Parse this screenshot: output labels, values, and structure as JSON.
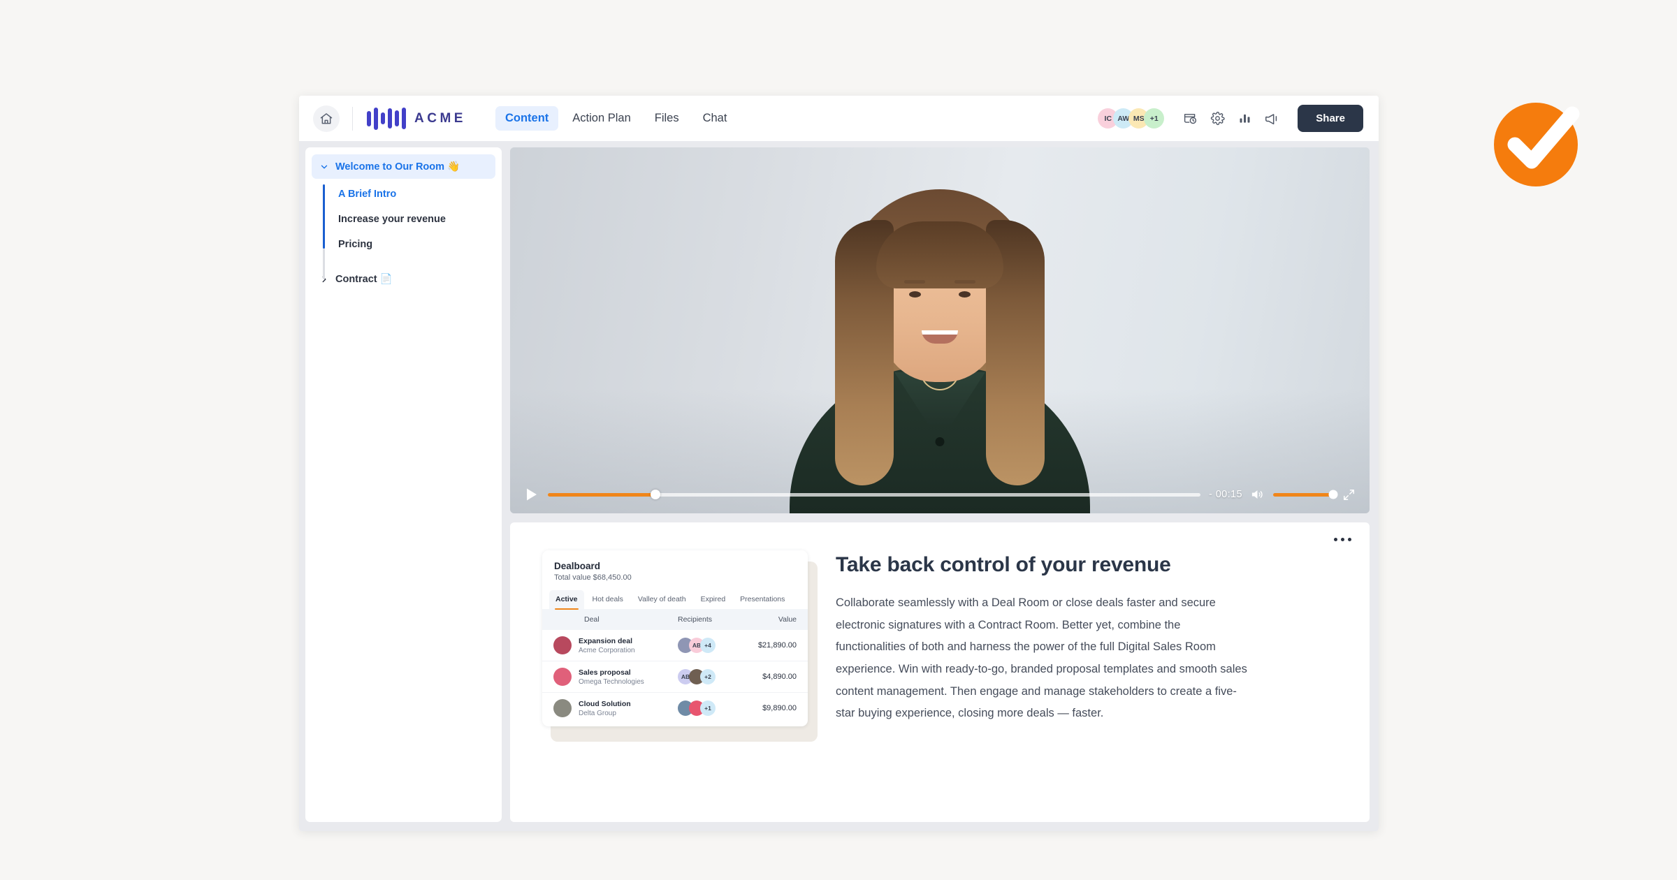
{
  "header": {
    "home_icon": "home-icon",
    "logo_text": "ACME",
    "nav": [
      {
        "label": "Content",
        "active": true
      },
      {
        "label": "Action Plan",
        "active": false
      },
      {
        "label": "Files",
        "active": false
      },
      {
        "label": "Chat",
        "active": false
      }
    ],
    "avatars": [
      {
        "initials": "IC",
        "color": "#f9d0dc"
      },
      {
        "initials": "AW",
        "color": "#cdeaf6"
      },
      {
        "initials": "MS",
        "color": "#fbe8b4"
      },
      {
        "initials": "+1",
        "color": "#c8efcb"
      }
    ],
    "icons": [
      {
        "name": "activity-history-icon"
      },
      {
        "name": "gear-icon"
      },
      {
        "name": "bar-chart-icon"
      },
      {
        "name": "megaphone-icon"
      }
    ],
    "share_label": "Share"
  },
  "sidebar": {
    "group": {
      "label": "Welcome to Our Room 👋",
      "expanded": true
    },
    "children": [
      {
        "label": "A Brief Intro",
        "active": true
      },
      {
        "label": "Increase your revenue",
        "active": false
      },
      {
        "label": "Pricing",
        "active": false
      }
    ],
    "group2": {
      "label": "Contract 📄",
      "expanded": false
    }
  },
  "video": {
    "time_label": "- 00:15",
    "progress_percent": 16.5,
    "volume_percent": 100,
    "play_icon": "play-icon",
    "volume_icon": "volume-icon",
    "fullscreen_icon": "fullscreen-icon"
  },
  "content_card": {
    "menu_icon": "more-options-icon",
    "heading": "Take back control of your revenue",
    "body": "Collaborate seamlessly with a Deal Room or close deals faster and secure electronic signatures with a Contract Room. Better yet, combine the functionalities of both and harness the power of the full Digital Sales Room experience. Win with ready-to-go, branded proposal templates and smooth sales content management. Then engage and manage stakeholders to create a five-star buying experience, closing more deals — faster.",
    "dealboard": {
      "title": "Dealboard",
      "subtitle": "Total value $68,450.00",
      "tabs": [
        {
          "label": "Active",
          "active": true
        },
        {
          "label": "Hot deals",
          "active": false
        },
        {
          "label": "Valley of death",
          "active": false
        },
        {
          "label": "Expired",
          "active": false
        },
        {
          "label": "Presentations",
          "active": false
        }
      ],
      "columns": [
        "Deal",
        "Recipients",
        "Value"
      ],
      "rows": [
        {
          "deal": "Expansion deal",
          "company": "Acme Corporation",
          "avatar_color": "#b8495e",
          "recipients": [
            {
              "initials": "",
              "color": "#8f96b4"
            },
            {
              "initials": "AB",
              "color": "#f9ccd9"
            },
            {
              "initials": "+4",
              "color": "#cfe9f7"
            }
          ],
          "value": "$21,890.00"
        },
        {
          "deal": "Sales proposal",
          "company": "Omega Technologies",
          "avatar_color": "#e0607a",
          "recipients": [
            {
              "initials": "AB",
              "color": "#ccccf0"
            },
            {
              "initials": "",
              "color": "#6f5f52"
            },
            {
              "initials": "+2",
              "color": "#cfe9f7"
            }
          ],
          "value": "$4,890.00"
        },
        {
          "deal": "Cloud Solution",
          "company": "Delta Group",
          "avatar_color": "#8a8a80",
          "recipients": [
            {
              "initials": "",
              "color": "#6f8ba6"
            },
            {
              "initials": "",
              "color": "#e8556f"
            },
            {
              "initials": "+1",
              "color": "#cfe9f7"
            }
          ],
          "value": "$9,890.00"
        }
      ]
    }
  },
  "brand_badge": {
    "icon": "orange-checkmark-badge",
    "circle_color": "#f57c0d",
    "check_color": "#ffffff"
  }
}
